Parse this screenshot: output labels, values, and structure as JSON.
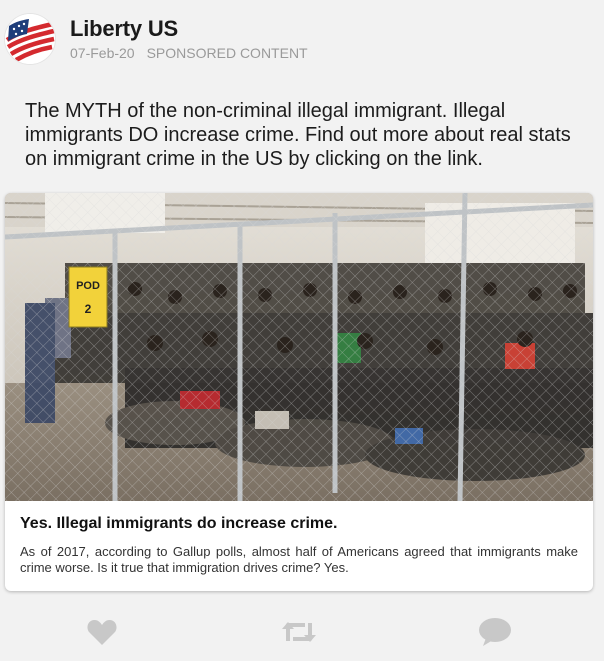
{
  "account": {
    "name": "Liberty US",
    "date": "07-Feb-20",
    "label": "SPONSORED CONTENT",
    "avatar_icon": "us-flag-logo-icon"
  },
  "post": {
    "text": "The MYTH of the non-criminal illegal immigrant. Illegal immigrants DO increase crime. Find out more about real stats on immigrant crime in the US by clicking on the link."
  },
  "link_card": {
    "image_description_icon": "photo-detention-facility",
    "sign_text": [
      "POD",
      "2"
    ],
    "title": "Yes. Illegal immigrants do increase crime.",
    "description": "As of 2017, according to Gallup polls, almost half of Americans agreed that immigrants make crime worse. Is it true that immigration drives crime? Yes."
  },
  "actions": [
    {
      "icon": "heart-icon"
    },
    {
      "icon": "retweet-icon"
    },
    {
      "icon": "comment-icon"
    }
  ],
  "colors": {
    "background": "#f2f2f2",
    "card": "#ffffff",
    "action_icons": "#c8c8c8",
    "flag_red": "#d42a2f",
    "flag_blue": "#1f3d7a",
    "meta_text": "#9a9a9a"
  }
}
